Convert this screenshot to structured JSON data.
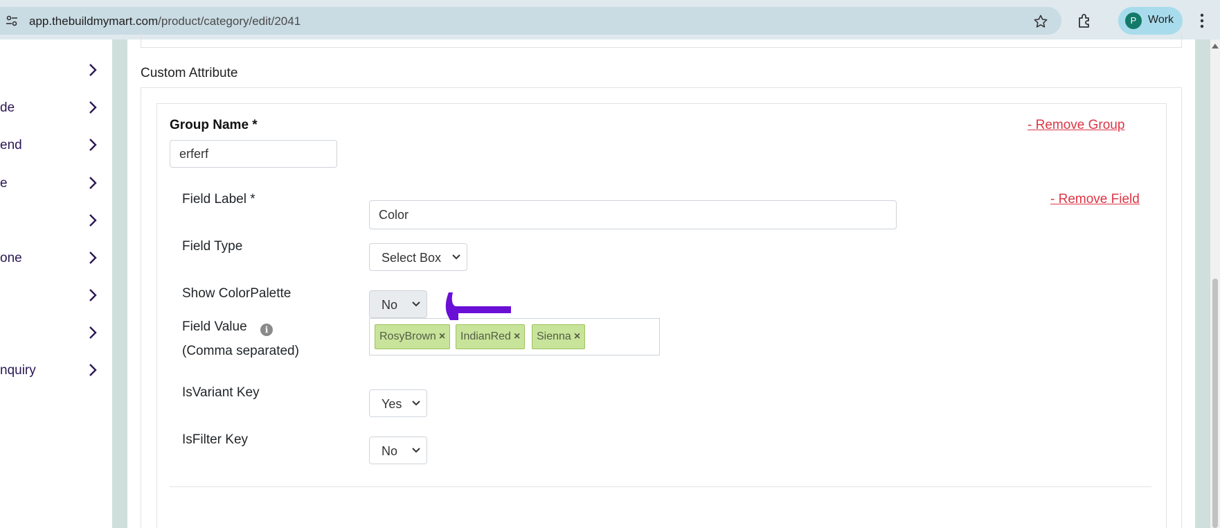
{
  "browser": {
    "url_domain": "app.thebuildmymart.com",
    "url_path": "/product/category/edit/2041",
    "profile_initial": "P",
    "profile_name": "Work",
    "icons": [
      "tune-icon",
      "star-icon",
      "extensions-icon",
      "more-vert-icon"
    ]
  },
  "sidebar": {
    "items": [
      {
        "label": ""
      },
      {
        "label": "de"
      },
      {
        "label": "end"
      },
      {
        "label": "e"
      },
      {
        "label": ""
      },
      {
        "label": "one"
      },
      {
        "label": ""
      },
      {
        "label": ""
      },
      {
        "label": "nquiry"
      }
    ]
  },
  "section": {
    "title": "Custom Attribute"
  },
  "group": {
    "label": "Group Name *",
    "value": "erferf",
    "remove_label": "- Remove Group"
  },
  "field": {
    "remove_label": "- Remove Field",
    "label_label": "Field Label *",
    "label_value": "Color",
    "type_label": "Field Type",
    "type_value": "Select Box",
    "palette_label": "Show ColorPalette",
    "palette_value": "No",
    "value_label": "Field Value",
    "value_hint": "(Comma separated)",
    "value_info_icon": "i",
    "tags": [
      "RosyBrown",
      "IndianRed",
      "Sienna"
    ],
    "tag_remove": "×",
    "variant_label": "IsVariant Key",
    "variant_value": "Yes",
    "filter_label": "IsFilter Key",
    "filter_value": "No"
  },
  "colors": {
    "accent_red": "#dc3545",
    "tag_bg": "#c8e49b",
    "annotation_arrow": "#6a0fd6",
    "strip": "#cfe0dc"
  }
}
